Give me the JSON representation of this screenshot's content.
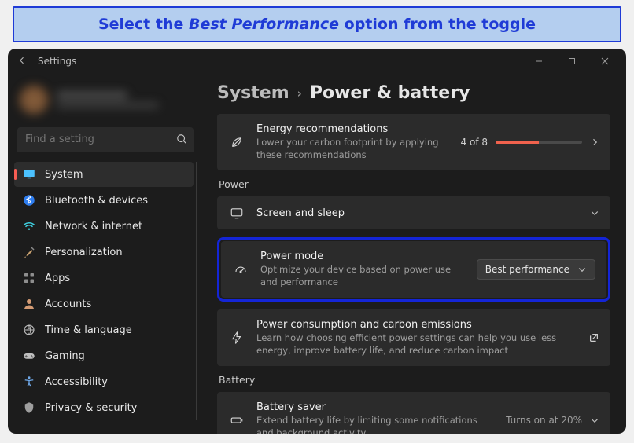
{
  "callout": {
    "pre": "Select the ",
    "em": "Best Performance",
    "post": " option from the toggle"
  },
  "window": {
    "title": "Settings"
  },
  "search": {
    "placeholder": "Find a setting"
  },
  "nav": [
    {
      "label": "System",
      "icon": "monitor",
      "active": true
    },
    {
      "label": "Bluetooth & devices",
      "icon": "bluetooth"
    },
    {
      "label": "Network & internet",
      "icon": "wifi"
    },
    {
      "label": "Personalization",
      "icon": "brush"
    },
    {
      "label": "Apps",
      "icon": "grid"
    },
    {
      "label": "Accounts",
      "icon": "person"
    },
    {
      "label": "Time & language",
      "icon": "globe"
    },
    {
      "label": "Gaming",
      "icon": "gamepad"
    },
    {
      "label": "Accessibility",
      "icon": "accessibility"
    },
    {
      "label": "Privacy & security",
      "icon": "shield"
    }
  ],
  "breadcrumb": {
    "parent": "System",
    "current": "Power & battery"
  },
  "energy": {
    "title": "Energy recommendations",
    "subtitle": "Lower your carbon footprint by applying these recommendations",
    "count": "4 of 8",
    "progress_pct": 50
  },
  "sections": {
    "power": "Power",
    "battery": "Battery"
  },
  "screen_sleep": {
    "title": "Screen and sleep"
  },
  "power_mode": {
    "title": "Power mode",
    "subtitle": "Optimize your device based on power use and performance",
    "selected": "Best performance"
  },
  "consumption": {
    "title": "Power consumption and carbon emissions",
    "subtitle": "Learn how choosing efficient power settings can help you use less energy, improve battery life, and reduce carbon impact"
  },
  "battery_saver": {
    "title": "Battery saver",
    "subtitle": "Extend battery life by limiting some notifications and background activity",
    "status": "Turns on at 20%"
  },
  "colors": {
    "accent": "#f65d53",
    "highlight": "#1425d6"
  }
}
